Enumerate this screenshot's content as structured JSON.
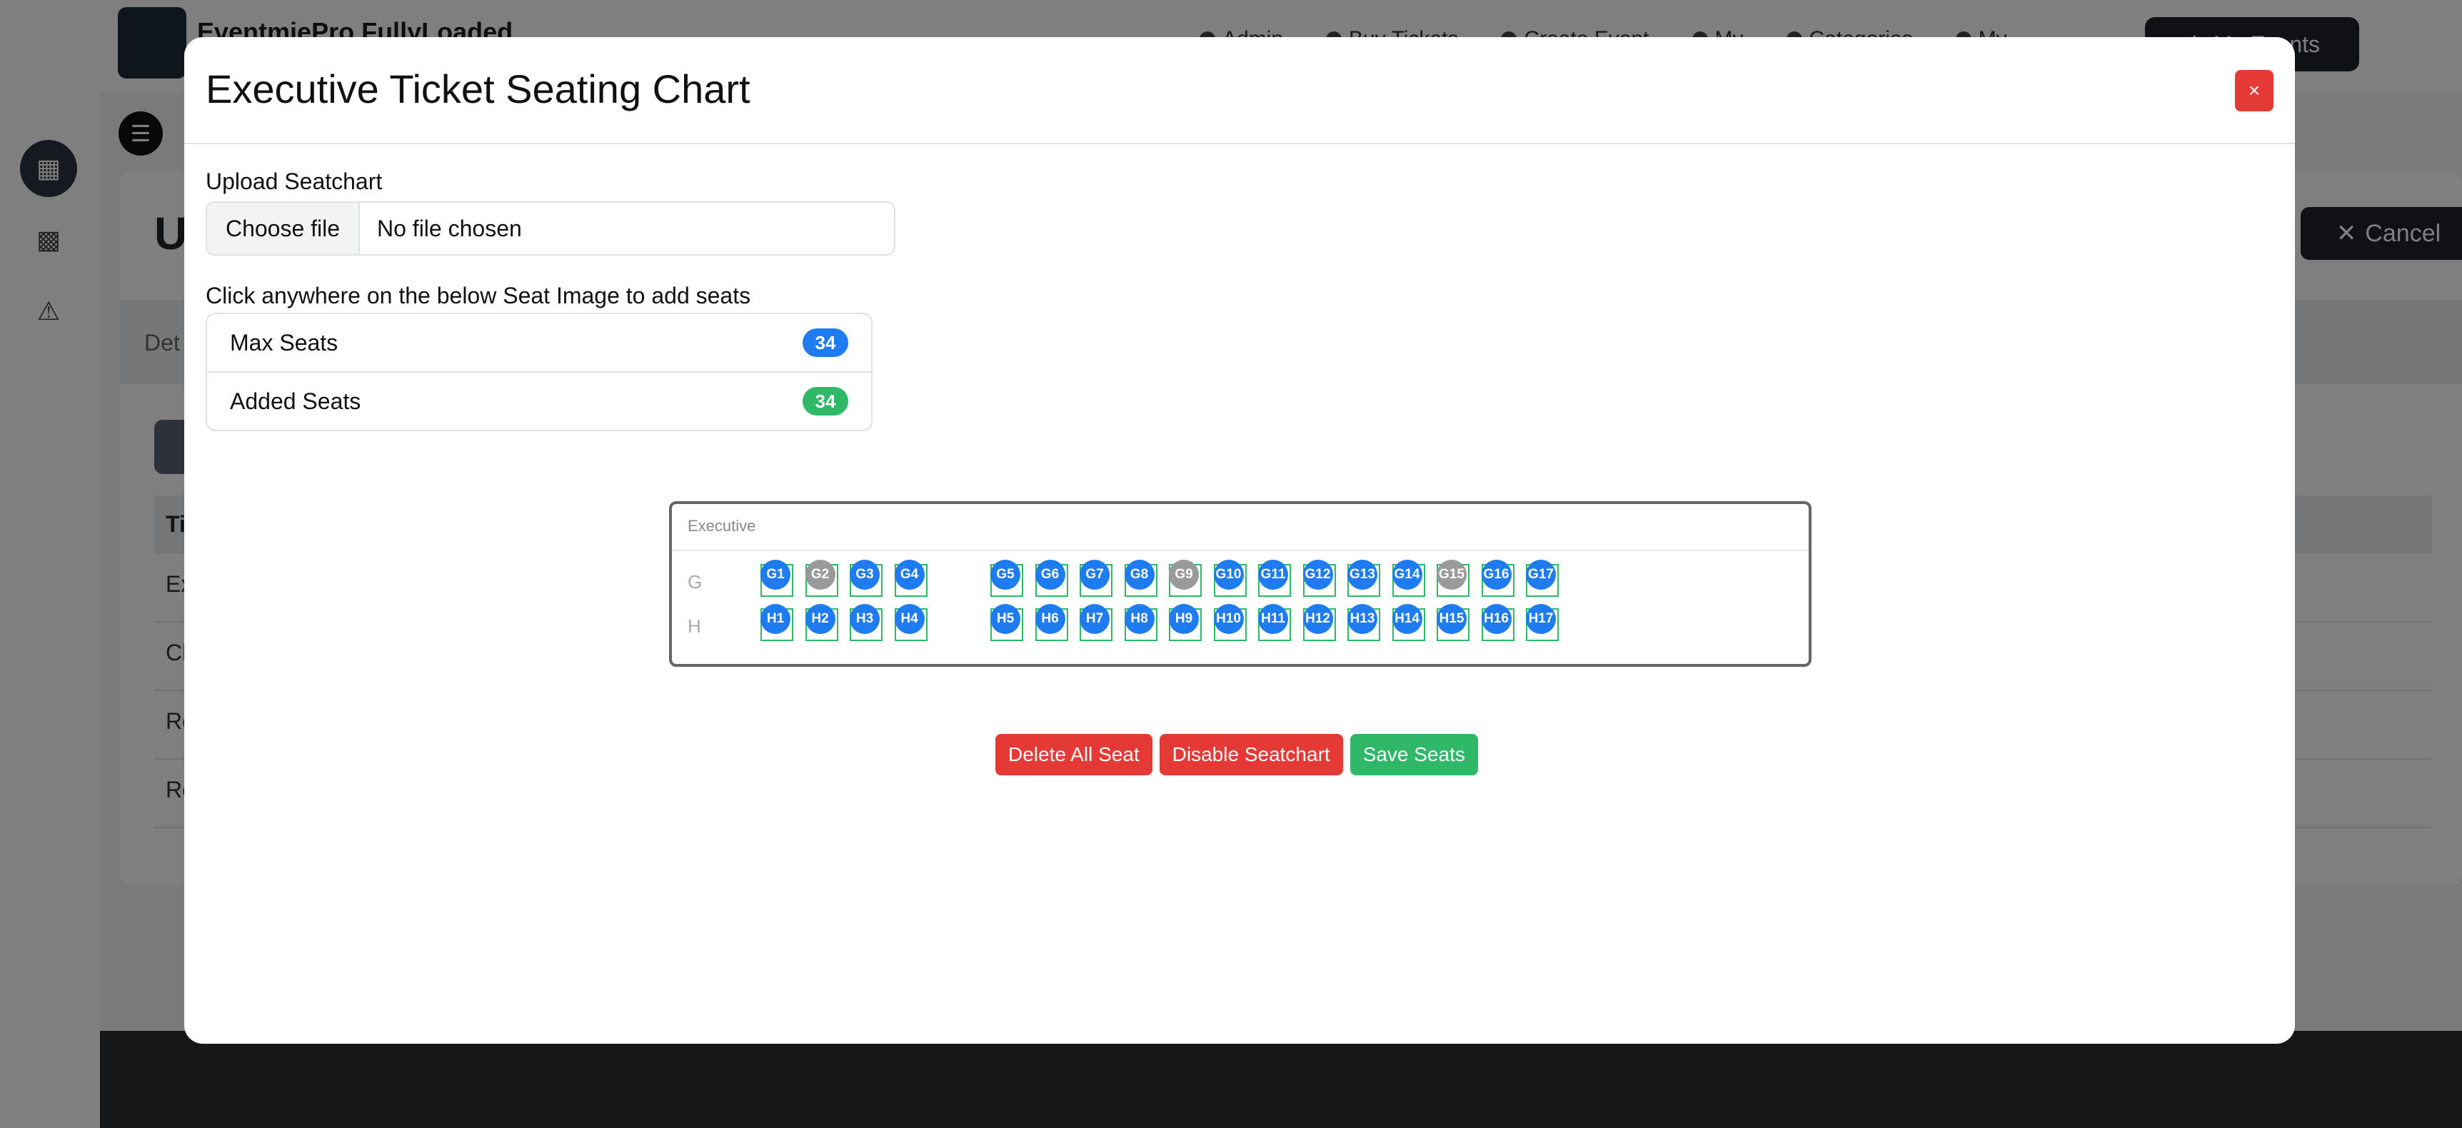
{
  "app": {
    "name": "EventmiePro FullyLoaded",
    "nav": [
      "Admin",
      "Buy Tickets",
      "Create Event",
      "My",
      "Categories",
      "My"
    ],
    "my_events_label": "My Events"
  },
  "background": {
    "title_initial": "U",
    "cancel_label": "Cancel",
    "tab_label": "Det",
    "table_header": "Ti",
    "rows": [
      "Ex",
      "Cl",
      "Re",
      "Re"
    ]
  },
  "modal": {
    "title": "Executive Ticket Seating Chart",
    "close_label": "×",
    "upload_label": "Upload Seatchart",
    "choose_file_label": "Choose file",
    "file_status": "No file chosen",
    "click_hint": "Click anywhere on the below Seat Image to add seats",
    "max_seats_label": "Max Seats",
    "max_seats_value": "34",
    "added_seats_label": "Added Seats",
    "added_seats_value": "34",
    "colors": {
      "enabled": "#1e7cf0",
      "disabled": "#9a9a9a",
      "border": "#2fb867"
    }
  },
  "seatchart": {
    "section_name": "Executive",
    "rows": [
      {
        "label": "G",
        "seats": [
          {
            "label": "G1",
            "disabled": false
          },
          {
            "label": "G2",
            "disabled": true
          },
          {
            "label": "G3",
            "disabled": false
          },
          {
            "label": "G4",
            "disabled": false
          },
          {
            "label": "G5",
            "disabled": false
          },
          {
            "label": "G6",
            "disabled": false
          },
          {
            "label": "G7",
            "disabled": false
          },
          {
            "label": "G8",
            "disabled": false
          },
          {
            "label": "G9",
            "disabled": true
          },
          {
            "label": "G10",
            "disabled": false
          },
          {
            "label": "G11",
            "disabled": false
          },
          {
            "label": "G12",
            "disabled": false
          },
          {
            "label": "G13",
            "disabled": false
          },
          {
            "label": "G14",
            "disabled": false
          },
          {
            "label": "G15",
            "disabled": true
          },
          {
            "label": "G16",
            "disabled": false
          },
          {
            "label": "G17",
            "disabled": false
          }
        ]
      },
      {
        "label": "H",
        "seats": [
          {
            "label": "H1",
            "disabled": false
          },
          {
            "label": "H2",
            "disabled": false
          },
          {
            "label": "H3",
            "disabled": false
          },
          {
            "label": "H4",
            "disabled": false
          },
          {
            "label": "H5",
            "disabled": false
          },
          {
            "label": "H6",
            "disabled": false
          },
          {
            "label": "H7",
            "disabled": false
          },
          {
            "label": "H8",
            "disabled": false
          },
          {
            "label": "H9",
            "disabled": false
          },
          {
            "label": "H10",
            "disabled": false
          },
          {
            "label": "H11",
            "disabled": false
          },
          {
            "label": "H12",
            "disabled": false
          },
          {
            "label": "H13",
            "disabled": false
          },
          {
            "label": "H14",
            "disabled": false
          },
          {
            "label": "H15",
            "disabled": false
          },
          {
            "label": "H16",
            "disabled": false
          },
          {
            "label": "H17",
            "disabled": false
          }
        ]
      }
    ]
  },
  "actions": {
    "delete_all": "Delete All Seat",
    "disable_seatchart": "Disable Seatchart",
    "save_seats": "Save Seats"
  }
}
